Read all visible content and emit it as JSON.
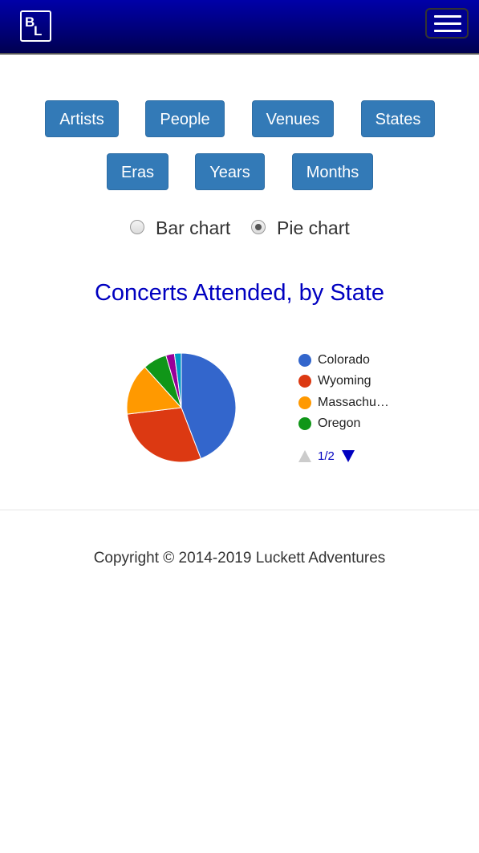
{
  "header": {
    "logo_text": "BL",
    "menu_icon": "hamburger-icon"
  },
  "category_buttons": [
    "Artists",
    "People",
    "Venues",
    "States",
    "Eras",
    "Years",
    "Months"
  ],
  "chart_type_options": {
    "bar_label": "Bar chart",
    "pie_label": "Pie chart",
    "selected": "Pie chart"
  },
  "chart_data": {
    "type": "pie",
    "title": "Concerts Attended, by State",
    "slices": [
      {
        "label": "Colorado",
        "value": 43.5,
        "color": "#3366cc"
      },
      {
        "label": "Wyoming",
        "value": 28.5,
        "color": "#dc3912"
      },
      {
        "label": "Massachu…",
        "value": 15.0,
        "color": "#ff9900"
      },
      {
        "label": "Oregon",
        "value": 7.0,
        "color": "#109618"
      },
      {
        "label": "",
        "value": 2.5,
        "color": "#990099"
      },
      {
        "label": "",
        "value": 2.0,
        "color": "#0099c6"
      }
    ],
    "legend_position": "right",
    "legend_page": "1/2"
  },
  "footer": {
    "copyright": "Copyright © 2014-2019 Luckett Adventures"
  }
}
